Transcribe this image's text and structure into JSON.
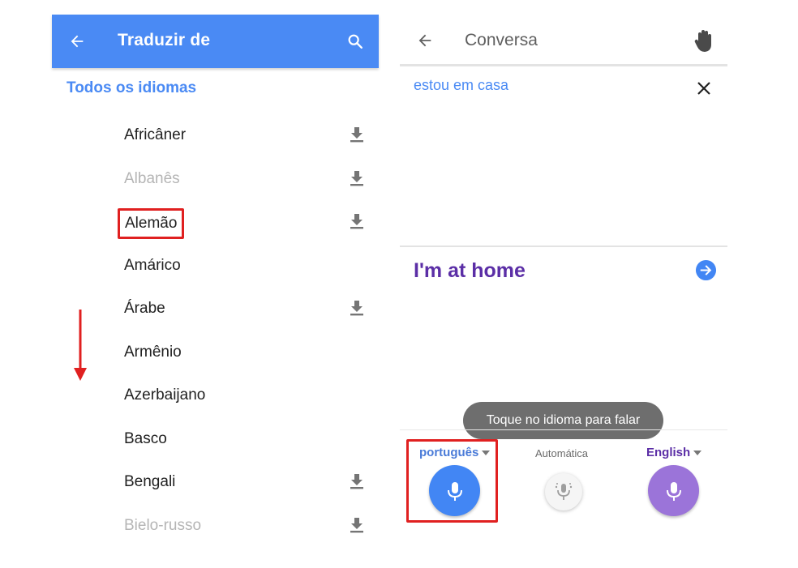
{
  "left": {
    "header_title": "Traduzir de",
    "section_label": "Todos os idiomas",
    "languages": [
      {
        "name": "Africâner",
        "download": true,
        "muted": false
      },
      {
        "name": "Albanês",
        "download": true,
        "muted": true
      },
      {
        "name": "Alemão",
        "download": true,
        "muted": false,
        "highlighted": true
      },
      {
        "name": "Amárico",
        "download": false,
        "muted": false
      },
      {
        "name": "Árabe",
        "download": true,
        "muted": false
      },
      {
        "name": "Armênio",
        "download": false,
        "muted": false
      },
      {
        "name": "Azerbaijano",
        "download": false,
        "muted": false
      },
      {
        "name": "Basco",
        "download": false,
        "muted": false
      },
      {
        "name": "Bengali",
        "download": true,
        "muted": false
      },
      {
        "name": "Bielo-russo",
        "download": true,
        "muted": true
      }
    ],
    "icons": {
      "back": "arrow-back-icon",
      "search": "search-icon",
      "download": "download-icon"
    }
  },
  "right": {
    "header_title": "Conversa",
    "source_text": "estou em casa",
    "target_text": "I'm at home",
    "toast": "Toque no idioma para falar",
    "lang_left": "português",
    "lang_auto": "Automática",
    "lang_right": "English",
    "icons": {
      "back": "arrow-back-icon",
      "hand": "hand-wave-icon",
      "close": "close-icon",
      "go": "arrow-forward-circle-icon",
      "mic": "microphone-icon"
    }
  },
  "colors": {
    "header_blue": "#4a8af4",
    "accent_blue": "#4286f4",
    "accent_purple": "#9b74d9",
    "target_purple": "#5b2ea6",
    "highlight_red": "#e02020"
  }
}
